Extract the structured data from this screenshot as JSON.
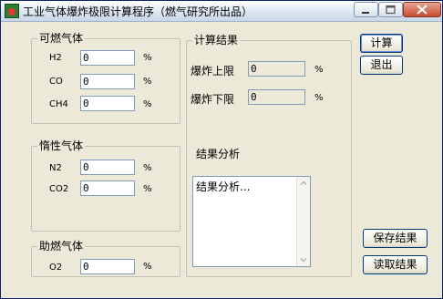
{
  "window": {
    "title": "工业气体爆炸极限计算程序（燃气研究所出品）"
  },
  "combustible_group": {
    "title": "可燃气体",
    "rows": [
      {
        "label": "H2",
        "value": "0",
        "unit": "%"
      },
      {
        "label": "CO",
        "value": "0",
        "unit": "%"
      },
      {
        "label": "CH4",
        "value": "0",
        "unit": "%"
      }
    ]
  },
  "inert_group": {
    "title": "惰性气体",
    "rows": [
      {
        "label": "N2",
        "value": "0",
        "unit": "%"
      },
      {
        "label": "CO2",
        "value": "0",
        "unit": "%"
      }
    ]
  },
  "oxidizer_group": {
    "title": "助燃气体",
    "rows": [
      {
        "label": "O2",
        "value": "0",
        "unit": "%"
      }
    ]
  },
  "results_group": {
    "title": "计算结果",
    "upper_label": "爆炸上限",
    "upper_value": "0",
    "upper_unit": "%",
    "lower_label": "爆炸下限",
    "lower_value": "0",
    "lower_unit": "%",
    "analysis_label": "结果分析",
    "analysis_text": "结果分析..."
  },
  "buttons": {
    "calculate": "计算",
    "exit": "退出",
    "save": "保存结果",
    "load": "读取结果"
  }
}
